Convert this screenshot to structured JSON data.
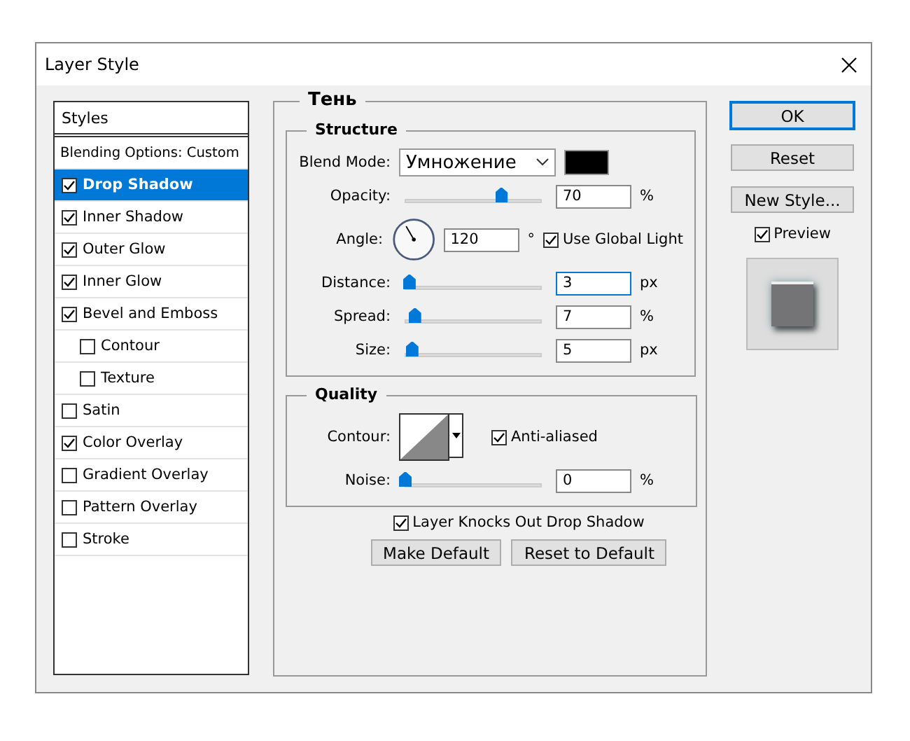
{
  "window": {
    "title": "Layer Style"
  },
  "styles_panel": {
    "header": "Styles",
    "blending_options": "Blending Options: Custom",
    "items": [
      {
        "label": "Drop Shadow",
        "checked": true,
        "selected": true
      },
      {
        "label": "Inner Shadow",
        "checked": true,
        "selected": false
      },
      {
        "label": "Outer Glow",
        "checked": true,
        "selected": false
      },
      {
        "label": "Inner Glow",
        "checked": true,
        "selected": false
      },
      {
        "label": "Bevel and Emboss",
        "checked": true,
        "selected": false,
        "children": [
          {
            "label": "Contour",
            "checked": false,
            "selected": false
          },
          {
            "label": "Texture",
            "checked": false,
            "selected": false
          }
        ]
      },
      {
        "label": "Satin",
        "checked": false,
        "selected": false
      },
      {
        "label": "Color Overlay",
        "checked": true,
        "selected": false
      },
      {
        "label": "Gradient Overlay",
        "checked": false,
        "selected": false
      },
      {
        "label": "Pattern Overlay",
        "checked": false,
        "selected": false
      },
      {
        "label": "Stroke",
        "checked": false,
        "selected": false
      }
    ]
  },
  "effect": {
    "title": "Тень",
    "structure": {
      "title": "Structure",
      "blend_mode": {
        "label": "Blend Mode:",
        "value": "Умножение",
        "color": "#000000"
      },
      "opacity": {
        "label": "Opacity:",
        "level": 0.7,
        "value": "70",
        "unit": "%"
      },
      "angle": {
        "label": "Angle:",
        "value": "120",
        "unit": "°",
        "use_global_light": {
          "label": "Use Global Light",
          "checked": true
        }
      },
      "sliders": [
        {
          "label": "Distance:",
          "level": 0.03,
          "value": "3",
          "unit": "px",
          "focused": true
        },
        {
          "label": "Spread:",
          "level": 0.07,
          "value": "7",
          "unit": "%",
          "focused": false
        },
        {
          "label": "Size:",
          "level": 0.05,
          "value": "5",
          "unit": "px",
          "focused": false
        }
      ]
    },
    "quality": {
      "title": "Quality",
      "contour_label": "Contour:",
      "anti_aliased": {
        "label": "Anti-aliased",
        "checked": true
      },
      "noise": {
        "label": "Noise:",
        "level": 0,
        "value": "0",
        "unit": "%"
      }
    },
    "knocks_out": {
      "label": "Layer Knocks Out Drop Shadow",
      "checked": true
    },
    "buttons": [
      "Make Default",
      "Reset to Default"
    ]
  },
  "actions": [
    {
      "label": "OK",
      "default": true
    },
    {
      "label": "Reset",
      "default": false
    },
    {
      "label": "New Style...",
      "default": false
    }
  ],
  "preview": {
    "label": "Preview",
    "checked": true
  }
}
